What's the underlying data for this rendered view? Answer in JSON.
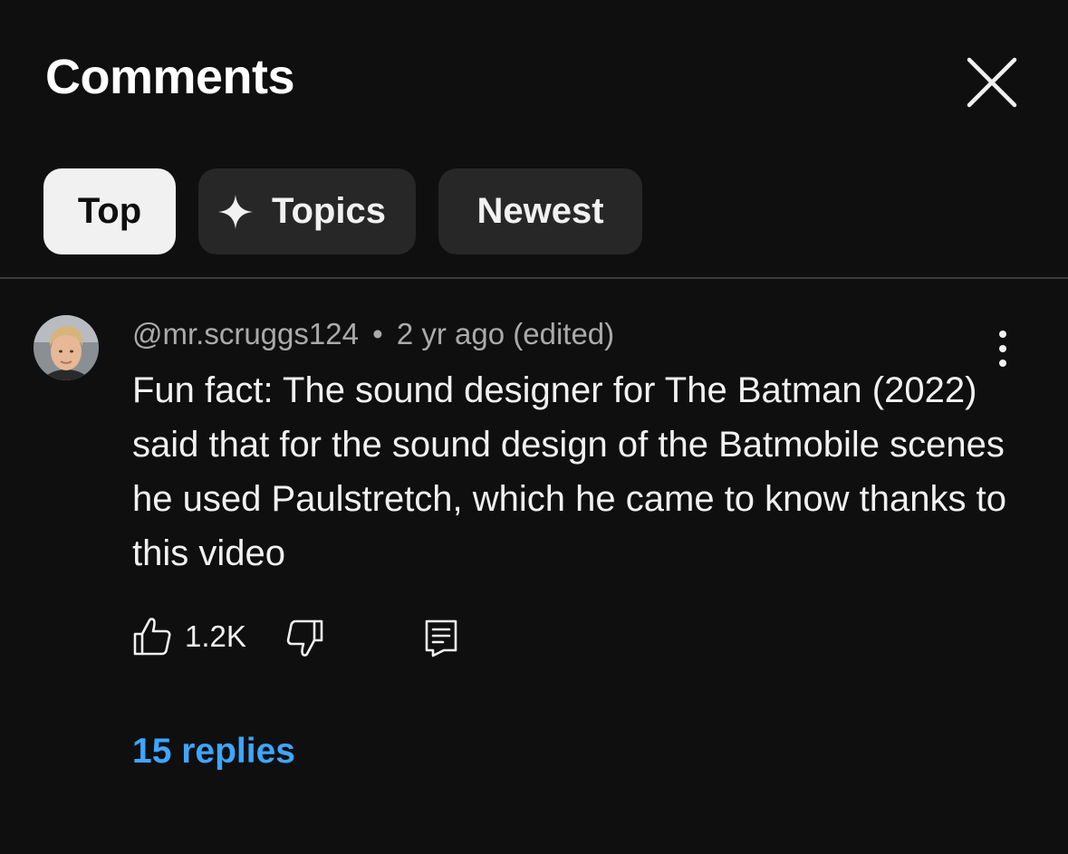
{
  "header": {
    "title": "Comments"
  },
  "chips": [
    {
      "label": "Top",
      "active": true
    },
    {
      "label": "Topics",
      "icon": "sparkle-icon",
      "active": false
    },
    {
      "label": "Newest",
      "active": false
    }
  ],
  "comment": {
    "author": "@mr.scruggs124",
    "separator": "•",
    "time": "2 yr ago (edited)",
    "text": "Fun fact: The sound designer for The Batman (2022) said that for the sound design of the Batmobile scenes he used Paulstretch, which he came to know thanks to this video",
    "like_count": "1.2K",
    "replies_label": "15 replies"
  },
  "colors": {
    "background": "#0f0f0f",
    "chip_bg": "#272727",
    "chip_active_bg": "#f1f1f1",
    "meta_text": "#aaaaaa",
    "link": "#3ea6ff"
  },
  "icons": {
    "close": "close-icon",
    "more": "more-vert-icon",
    "like": "thumbs-up-icon",
    "dislike": "thumbs-down-icon",
    "reply": "reply-comment-icon"
  }
}
